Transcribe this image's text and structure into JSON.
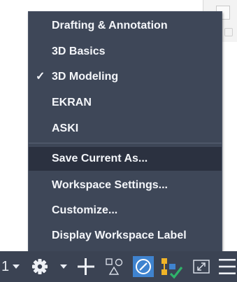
{
  "workspace_menu": {
    "items": [
      {
        "label": "Drafting & Annotation",
        "checked": false
      },
      {
        "label": "3D Basics",
        "checked": false
      },
      {
        "label": "3D Modeling",
        "checked": true
      },
      {
        "label": "EKRAN",
        "checked": false
      },
      {
        "label": "ASKI",
        "checked": false
      }
    ],
    "check_glyph": "✓",
    "actions": [
      {
        "label": "Save Current As...",
        "highlighted": true
      },
      {
        "label": "Workspace Settings...",
        "highlighted": false
      },
      {
        "label": "Customize...",
        "highlighted": false
      },
      {
        "label": "Display Workspace Label",
        "highlighted": false
      }
    ]
  },
  "status_bar": {
    "scale_fragment": "1",
    "icons": [
      "chevron-down-icon",
      "gear-icon",
      "chevron-down-icon",
      "plus-icon",
      "isolate-objects-icon",
      "hardware-acceleration-icon",
      "auto-scale-icon",
      "fullscreen-icon",
      "hamburger-menu-icon"
    ]
  },
  "colors": {
    "menu_bg": "#3e4758",
    "menu_highlight": "#2b3140",
    "menu_text": "#f4f6fa",
    "toolbar_bg": "#3b4353",
    "active_button": "#3f83cf",
    "accent_yellow": "#f0b428",
    "accent_green": "#2fb36a"
  }
}
